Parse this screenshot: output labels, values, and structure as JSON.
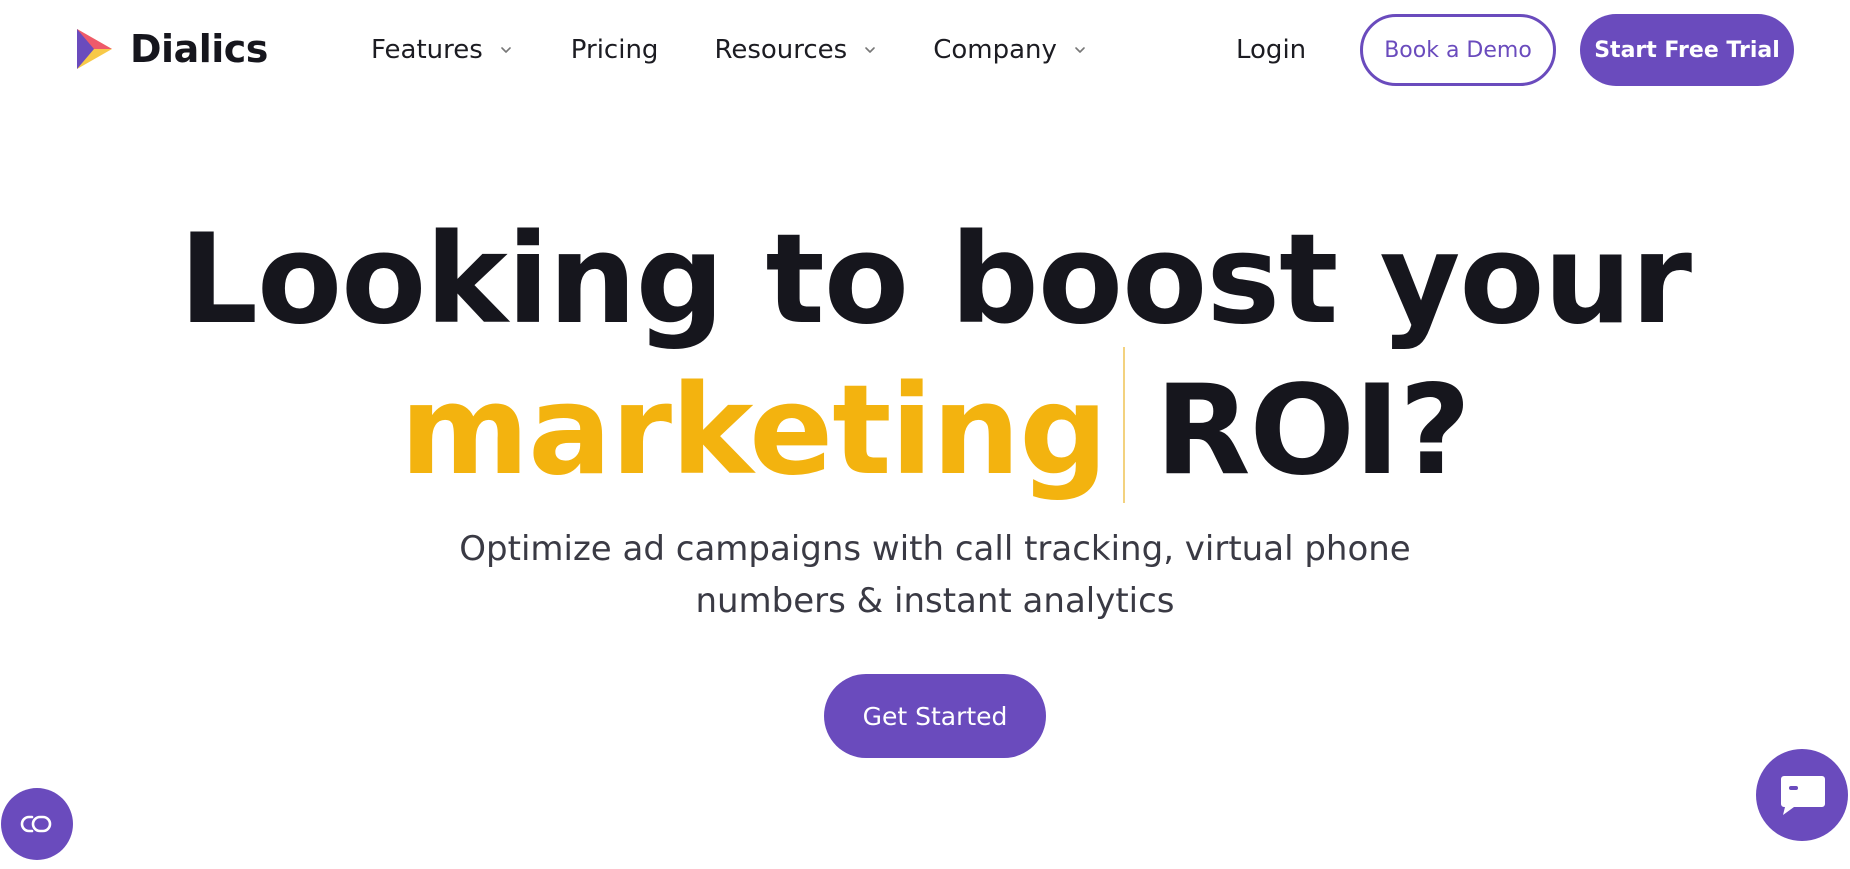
{
  "brand": {
    "name": "Dialics",
    "logo_icon": "play-triangle-logo",
    "colors": {
      "primary": "#6a4bbd",
      "accent_yellow": "#f3b30f",
      "logo_red": "#ee5a6b",
      "logo_yellow": "#f7c948",
      "logo_purple": "#6a4bbd"
    }
  },
  "nav": {
    "items": [
      {
        "label": "Features",
        "has_dropdown": true
      },
      {
        "label": "Pricing",
        "has_dropdown": false
      },
      {
        "label": "Resources",
        "has_dropdown": true
      },
      {
        "label": "Company",
        "has_dropdown": true
      }
    ],
    "login_label": "Login",
    "demo_label": "Book a Demo",
    "trial_label": "Start Free Trial"
  },
  "hero": {
    "line1": "Looking to boost your",
    "accent_word": "marketing",
    "line2_rest": "ROI?",
    "subtitle": "Optimize ad campaigns with call tracking, virtual phone numbers & instant analytics",
    "cta_label": "Get Started"
  },
  "widgets": {
    "left_icon": "accessibility-toggle-icon",
    "right_icon": "chat-bubble-icon"
  }
}
